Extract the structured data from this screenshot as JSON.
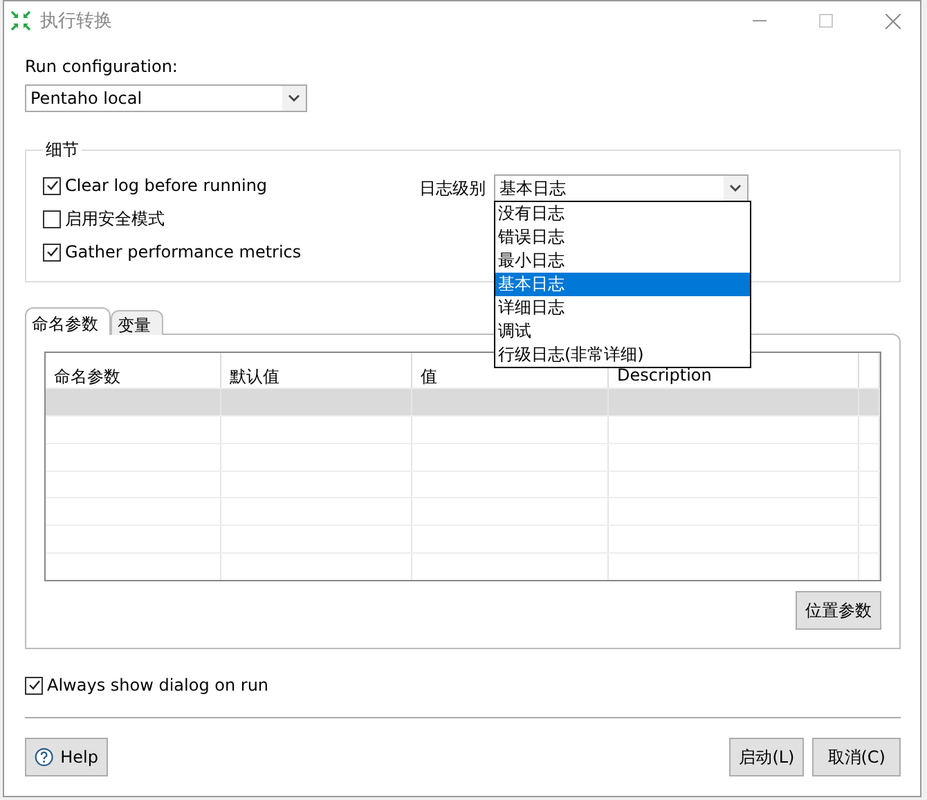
{
  "window": {
    "title": "执行转换"
  },
  "run_configuration": {
    "label": "Run configuration:",
    "value": "Pentaho local"
  },
  "details": {
    "legend": "细节",
    "checkboxes": [
      {
        "label": "Clear log before running",
        "checked": true
      },
      {
        "label": "启用安全模式",
        "checked": false
      },
      {
        "label": "Gather performance metrics",
        "checked": true
      }
    ],
    "log_level": {
      "label": "日志级别",
      "value": "基本日志",
      "expanded": true,
      "options": [
        {
          "label": "没有日志",
          "selected": false
        },
        {
          "label": "错误日志",
          "selected": false
        },
        {
          "label": "最小日志",
          "selected": false
        },
        {
          "label": "基本日志",
          "selected": true
        },
        {
          "label": "详细日志",
          "selected": false
        },
        {
          "label": "调试",
          "selected": false
        },
        {
          "label": "行级日志(非常详细)",
          "selected": false
        }
      ]
    }
  },
  "tabs": [
    {
      "label": "命名参数",
      "selected": true
    },
    {
      "label": "变量",
      "selected": false
    }
  ],
  "table": {
    "columns": [
      "命名参数",
      "默认值",
      "值",
      "Description"
    ],
    "rows": [
      {
        "selected": true
      },
      {
        "selected": false
      },
      {
        "selected": false
      },
      {
        "selected": false
      },
      {
        "selected": false
      },
      {
        "selected": false
      },
      {
        "selected": false
      }
    ]
  },
  "position_button": "位置参数",
  "always_show": {
    "label": "Always show dialog on run",
    "checked": true
  },
  "buttons": {
    "help": "Help",
    "start": "启动(L)",
    "cancel": "取消(C)"
  }
}
